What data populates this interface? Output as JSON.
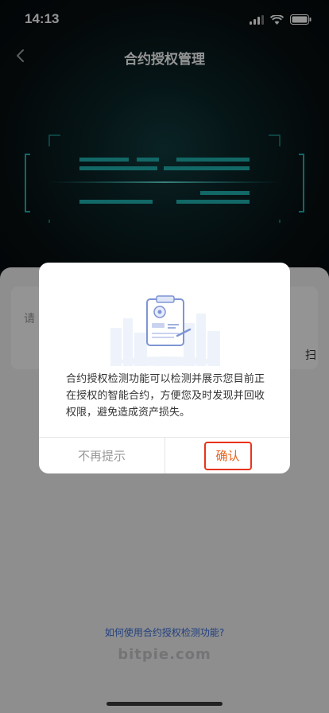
{
  "status_bar": {
    "time": "14:13"
  },
  "header": {
    "title": "合约授权管理"
  },
  "content": {
    "input_placeholder": "请",
    "scan_label": "扫",
    "help_link": "如何使用合约授权检测功能?",
    "watermark": "bitpie.com"
  },
  "dialog": {
    "message": "合约授权检测功能可以检测并展示您目前正在授权的智能合约，方便您及时发现并回收权限，避免造成资产损失。",
    "dismiss_label": "不再提示",
    "confirm_label": "确认"
  },
  "colors": {
    "accent": "#e8621c",
    "highlight_border": "#e8341c",
    "link": "#3a6fd8",
    "scan_teal": "#1fb4b0"
  },
  "icons": [
    "signal-icon",
    "wifi-icon",
    "battery-icon",
    "back-arrow-icon",
    "document-check-icon"
  ]
}
